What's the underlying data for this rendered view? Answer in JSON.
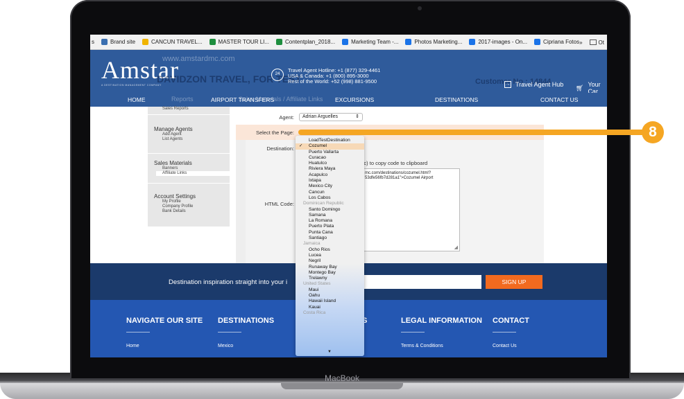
{
  "bookmarks": [
    {
      "label": "s",
      "color": "#999999"
    },
    {
      "label": "Brand site",
      "color": "#3a6fb0"
    },
    {
      "label": "CANCUN TRAVEL...",
      "color": "#f0b400"
    },
    {
      "label": "MASTER TOUR LI...",
      "color": "#1e8e3e"
    },
    {
      "label": "Contentplan_2018...",
      "color": "#1e8e3e"
    },
    {
      "label": "Marketing Team -...",
      "color": "#1a73e8"
    },
    {
      "label": "Photos Marketing...",
      "color": "#1a73e8"
    },
    {
      "label": "2017-images - On...",
      "color": "#1a73e8"
    },
    {
      "label": "Cipriana Fotos",
      "color": "#1a73e8"
    }
  ],
  "bookmarks_more": "»",
  "bookmarks_other": "Ot",
  "header": {
    "logo": "Amstar",
    "logo_sub": "A DESTINATION MANAGEMENT COMPANY",
    "url_faint": "www.amstardmc.com",
    "agency_faint": "DAVIDZON TRAVEL, FOR TEST",
    "customer_faint": "Customer No : 14844",
    "hotline_icon": "24",
    "hotline_lines": [
      "Travel Agent Hotline: +1 (877) 329-4461",
      "USA & Canada: +1 (800) 895-3000",
      "Rest of the World: +52 (998) 881-9500"
    ],
    "hub_label": "Travel Agent Hub",
    "cart_label": "Your Car"
  },
  "nav": {
    "items": [
      "HOME",
      "AIRPORT TRANSFERS",
      "EXCURSIONS",
      "DESTINATIONS",
      "CONTACT US"
    ],
    "faint_reports": "Reports",
    "faint_breadcrumb": "Sales Materials  /  Affiliate Links"
  },
  "sidebar": {
    "reports_item": "Sales Reports",
    "manage_title": "Manage Agents",
    "manage_items": [
      "Add Agent",
      "List Agents"
    ],
    "sales_title": "Sales Materials",
    "sales_items": [
      "Banners",
      "Affiliate Links"
    ],
    "account_title": "Account Settings",
    "account_items": [
      "My Profile",
      "Company Profile",
      "Bank Details"
    ]
  },
  "form": {
    "agent_label": "Agent:",
    "agent_value": "Adrian Arguelles",
    "page_label": "Select the Page:",
    "destination_label": "Destination:",
    "copy_hint": "Mac) to copy code to clipboard",
    "html_label": "HTML Code:",
    "code_lines": [
      "mc.com/destinations/cozumel.html?",
      "53dfe56fb7d281a1\">Cozumel Airport"
    ]
  },
  "dropdown": {
    "items": [
      {
        "label": "LoadTestDestination",
        "group": false,
        "selected": false
      },
      {
        "label": "Cozumel",
        "group": false,
        "selected": true
      },
      {
        "label": "Puerto Vallarta",
        "group": false,
        "selected": false
      },
      {
        "label": "Curacao",
        "group": false,
        "selected": false
      },
      {
        "label": "Huatulco",
        "group": false,
        "selected": false
      },
      {
        "label": "Riviera Maya",
        "group": false,
        "selected": false
      },
      {
        "label": "Acapulco",
        "group": false,
        "selected": false
      },
      {
        "label": "Ixtapa",
        "group": false,
        "selected": false
      },
      {
        "label": "Mexico City",
        "group": false,
        "selected": false
      },
      {
        "label": "Cancun",
        "group": false,
        "selected": false
      },
      {
        "label": "Los Cabos",
        "group": false,
        "selected": false
      },
      {
        "label": "Dominican Republic",
        "group": true,
        "selected": false
      },
      {
        "label": "Santo Domingo",
        "group": false,
        "selected": false
      },
      {
        "label": "Samana",
        "group": false,
        "selected": false
      },
      {
        "label": "La Romana",
        "group": false,
        "selected": false
      },
      {
        "label": "Puerto Plata",
        "group": false,
        "selected": false
      },
      {
        "label": "Punta Cana",
        "group": false,
        "selected": false
      },
      {
        "label": "Santiago",
        "group": false,
        "selected": false
      },
      {
        "label": "Jamaica",
        "group": true,
        "selected": false
      },
      {
        "label": "Ocho Rios",
        "group": false,
        "selected": false
      },
      {
        "label": "Lucea",
        "group": false,
        "selected": false
      },
      {
        "label": "Negril",
        "group": false,
        "selected": false
      },
      {
        "label": "Runaway Bay",
        "group": false,
        "selected": false
      },
      {
        "label": "Montego Bay",
        "group": false,
        "selected": false
      },
      {
        "label": "Trelawny",
        "group": false,
        "selected": false
      },
      {
        "label": "United States",
        "group": true,
        "selected": false
      },
      {
        "label": "Maui",
        "group": false,
        "selected": false
      },
      {
        "label": "Oahu",
        "group": false,
        "selected": false
      },
      {
        "label": "Hawaii Island",
        "group": false,
        "selected": false
      },
      {
        "label": "Kauai",
        "group": false,
        "selected": false
      },
      {
        "label": "Costa Rica",
        "group": true,
        "selected": false
      }
    ],
    "check_glyph": "✓",
    "scroll_arrow": "▼"
  },
  "signup": {
    "text": "Destination inspiration straight into your i",
    "placeholder": "il.com",
    "button": "SIGN UP"
  },
  "footer": {
    "headings": [
      "NAVIGATE OUR SITE",
      "DESTINATIONS",
      "S",
      "LEGAL INFORMATION",
      "CONTACT"
    ],
    "links": [
      "Home",
      "Mexico",
      "Terms & Conditions",
      "Contact Us"
    ]
  },
  "callout": {
    "number": "8",
    "color": "#f5a623"
  },
  "device_label": "MacBook"
}
